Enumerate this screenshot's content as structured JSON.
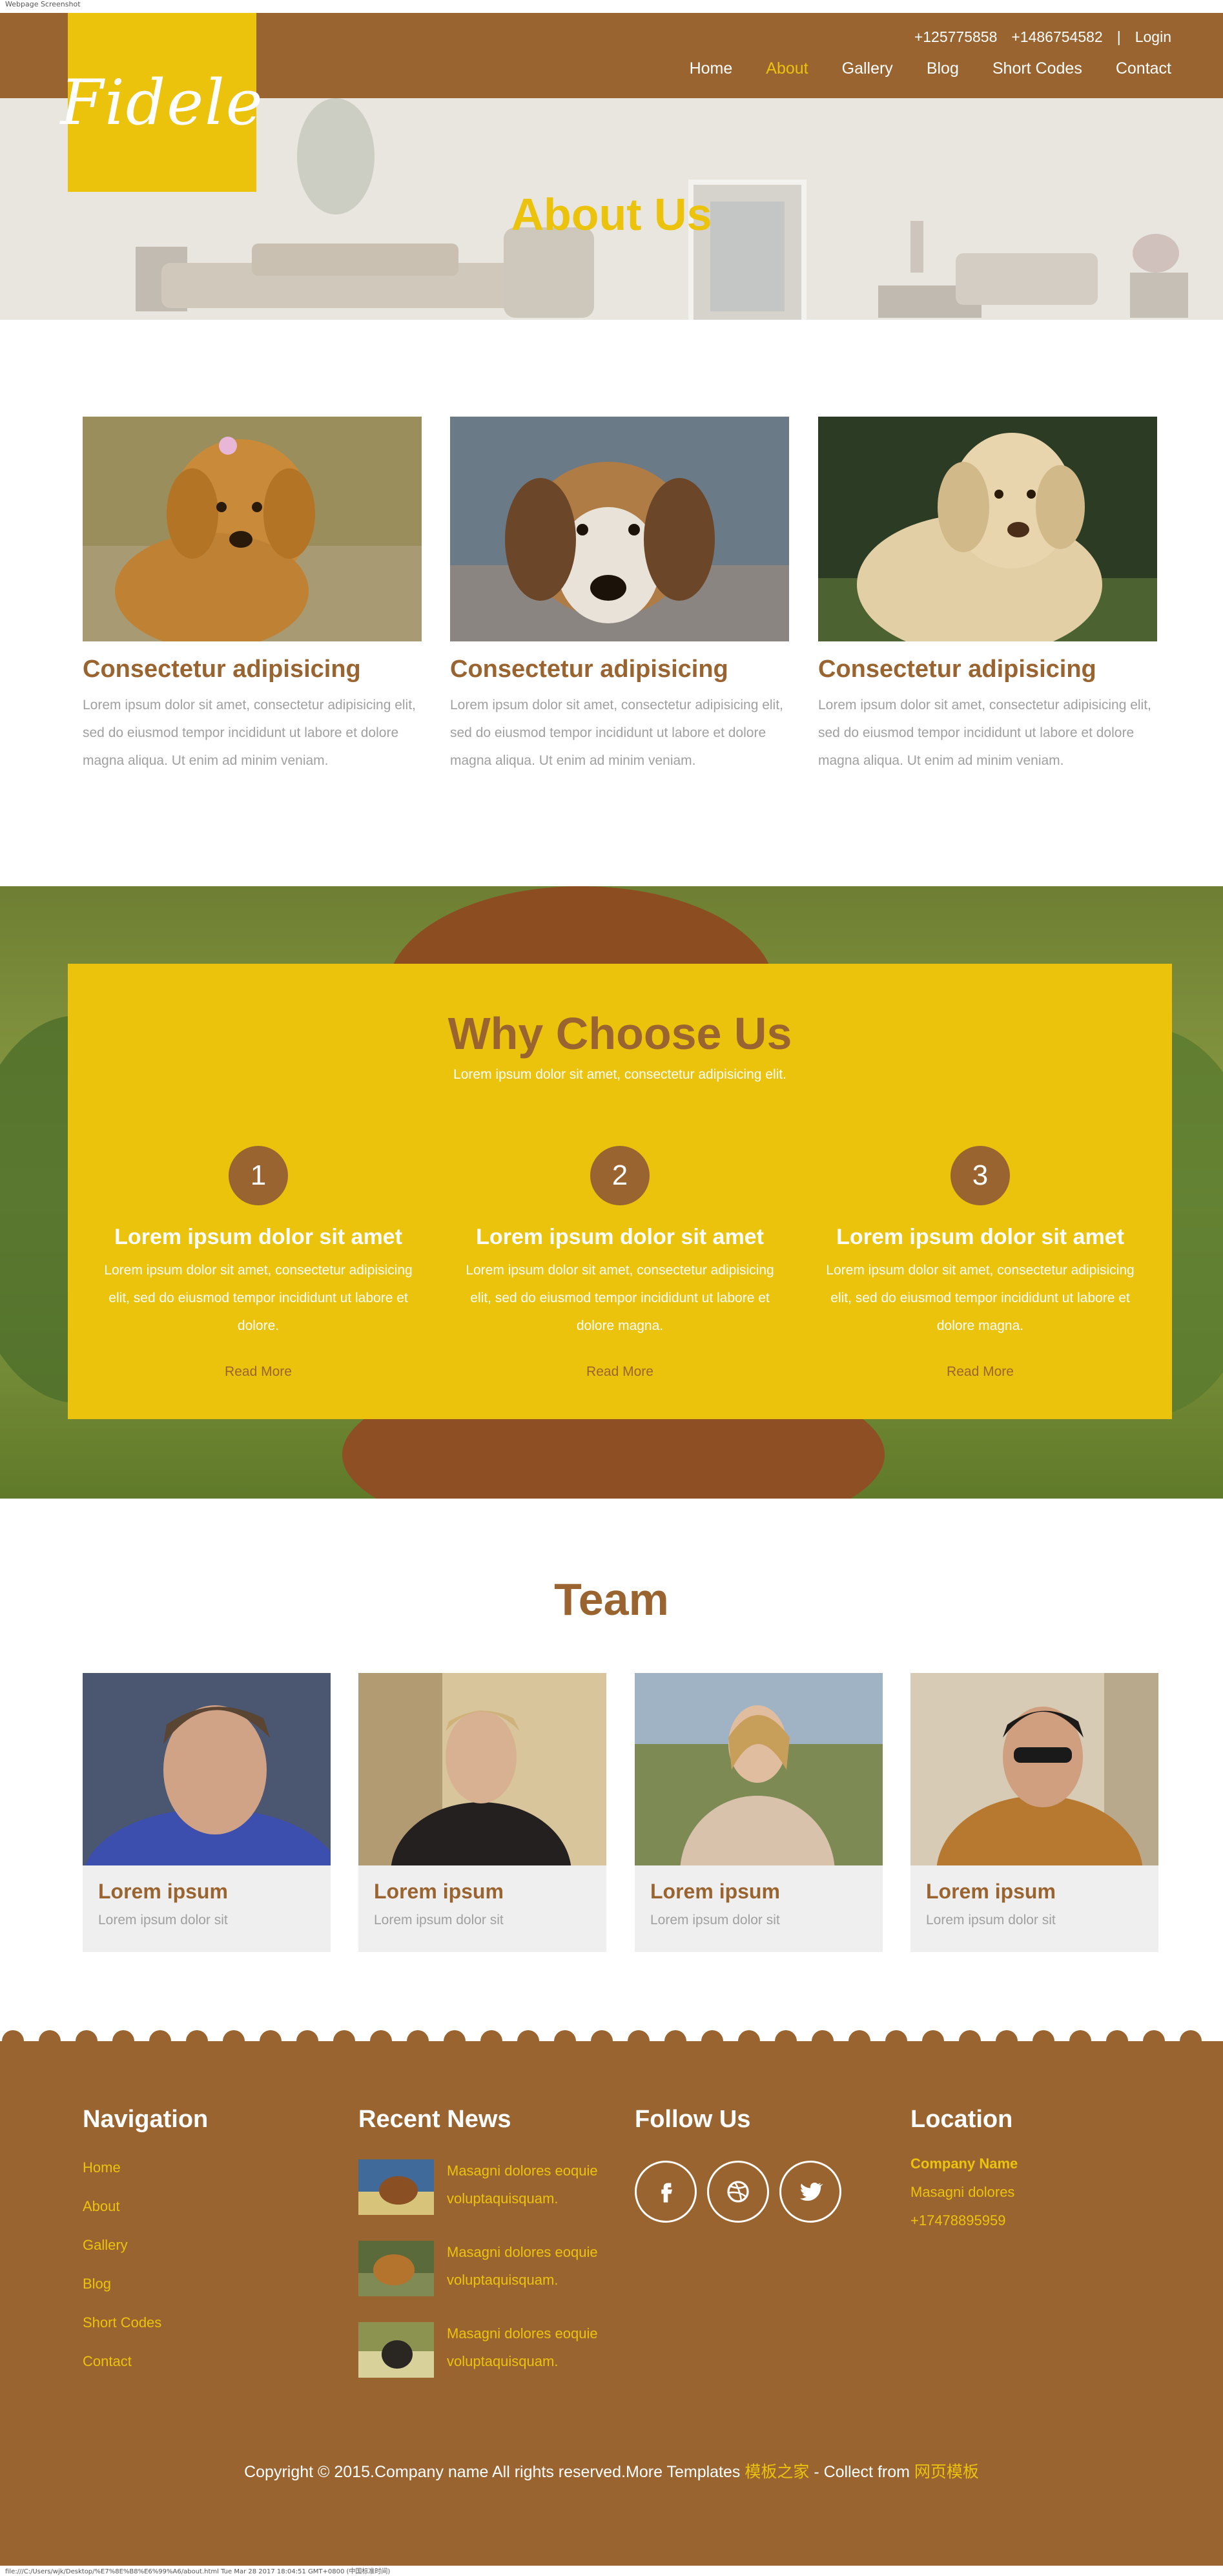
{
  "top_note": "Webpage Screenshot",
  "header": {
    "logo": "Fidele",
    "phone1": "+125775858",
    "phone2": "+1486754582",
    "separator": "|",
    "login": "Login",
    "nav": [
      "Home",
      "About",
      "Gallery",
      "Blog",
      "Short Codes",
      "Contact"
    ],
    "active_nav": "About"
  },
  "hero": {
    "title": "About Us"
  },
  "cards": [
    {
      "title": "Consectetur adipisicing",
      "text": "Lorem ipsum dolor sit amet, consectetur adipisicing elit, sed do eiusmod tempor incididunt ut labore et dolore magna aliqua. Ut enim ad minim veniam.",
      "image": "golden-doodle-photo"
    },
    {
      "title": "Consectetur adipisicing",
      "text": "Lorem ipsum dolor sit amet, consectetur adipisicing elit, sed do eiusmod tempor incididunt ut labore et dolore magna aliqua. Ut enim ad minim veniam.",
      "image": "beagle-photo"
    },
    {
      "title": "Consectetur adipisicing",
      "text": "Lorem ipsum dolor sit amet, consectetur adipisicing elit, sed do eiusmod tempor incididunt ut labore et dolore magna aliqua. Ut enim ad minim veniam.",
      "image": "labrador-photo"
    }
  ],
  "why": {
    "title": "Why Choose Us",
    "subtitle": "Lorem ipsum dolor sit amet, consectetur adipisicing elit.",
    "items": [
      {
        "num": "1",
        "title": "Lorem ipsum dolor sit amet",
        "text": "Lorem ipsum dolor sit amet, consectetur adipisicing elit, sed do eiusmod tempor incididunt ut labore et dolore.",
        "more": "Read More"
      },
      {
        "num": "2",
        "title": "Lorem ipsum dolor sit amet",
        "text": "Lorem ipsum dolor sit amet, consectetur adipisicing elit, sed do eiusmod tempor incididunt ut labore et dolore magna.",
        "more": "Read More"
      },
      {
        "num": "3",
        "title": "Lorem ipsum dolor sit amet",
        "text": "Lorem ipsum dolor sit amet, consectetur adipisicing elit, sed do eiusmod tempor incididunt ut labore et dolore magna.",
        "more": "Read More"
      }
    ]
  },
  "team": {
    "title": "Team",
    "members": [
      {
        "name": "Lorem ipsum",
        "role": "Lorem ipsum dolor sit"
      },
      {
        "name": "Lorem ipsum",
        "role": "Lorem ipsum dolor sit"
      },
      {
        "name": "Lorem ipsum",
        "role": "Lorem ipsum dolor sit"
      },
      {
        "name": "Lorem ipsum",
        "role": "Lorem ipsum dolor sit"
      }
    ]
  },
  "footer": {
    "nav_title": "Navigation",
    "nav": [
      "Home",
      "About",
      "Gallery",
      "Blog",
      "Short Codes",
      "Contact"
    ],
    "news_title": "Recent News",
    "news": [
      {
        "text": "Masagni dolores eoquie voluptaquisquam."
      },
      {
        "text": "Masagni dolores eoquie voluptaquisquam."
      },
      {
        "text": "Masagni dolores eoquie voluptaquisquam."
      }
    ],
    "follow_title": "Follow Us",
    "social": [
      "facebook-icon",
      "dribbble-icon",
      "twitter-icon"
    ],
    "location_title": "Location",
    "company": "Company Name",
    "address": "Masagni dolores",
    "phone": "+17478895959",
    "copyright_main": "Copyright © 2015.Company name All rights reserved.More Templates ",
    "copyright_link1": "模板之家",
    "copyright_mid": " - Collect from ",
    "copyright_link2": "网页模板"
  },
  "bottom_note": "file:///C:/Users/wjk/Desktop/%E7%8E%B8%E6%99%A6/about.html Tue Mar 28 2017 18:04:51 GMT+0800 (中国标准时间)",
  "colors": {
    "brown": "#9a6430",
    "yellow": "#ebc30d"
  }
}
